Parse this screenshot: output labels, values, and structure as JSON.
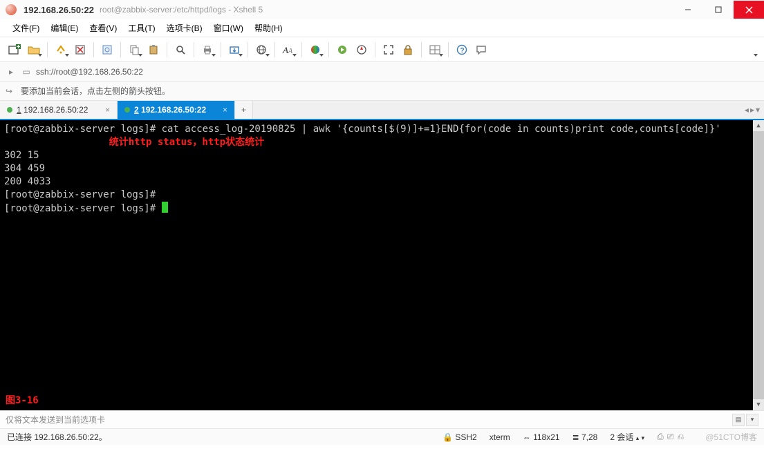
{
  "window": {
    "title_main": "192.168.26.50:22",
    "title_sub": "root@zabbix-server:/etc/httpd/logs - Xshell 5"
  },
  "menu": {
    "file": "文件(F)",
    "edit": "编辑(E)",
    "view": "查看(V)",
    "tools": "工具(T)",
    "tabs": "选项卡(B)",
    "window": "窗口(W)",
    "help": "帮助(H)"
  },
  "address": {
    "url": "ssh://root@192.168.26.50:22"
  },
  "hint": {
    "text": "要添加当前会话，点击左侧的箭头按钮。"
  },
  "tabs": {
    "t1_num": "1",
    "t1_label": "192.168.26.50:22",
    "t2_num": "2",
    "t2_label": "192.168.26.50:22"
  },
  "terminal": {
    "line1": "[root@zabbix-server logs]# cat access_log-20190825 | awk '{counts[$(9)]+=1}END{for(code in counts)print code,counts[code]}'",
    "annotation": "统计http status，http状态统计",
    "line2": "302 15",
    "line3": "304 459",
    "line4": "200 4033",
    "line5": "[root@zabbix-server logs]#",
    "line6": "[root@zabbix-server logs]# ",
    "figure_label": "图3-16"
  },
  "sendbar": {
    "placeholder": "仅将文本发送到当前选项卡"
  },
  "status": {
    "conn": "已连接 192.168.26.50:22。",
    "proto": "SSH2",
    "term": "xterm",
    "size": "118x21",
    "pos": "7,28",
    "sessions": "2 会话",
    "watermark": "@51CTO博客"
  },
  "icons": {
    "lock": "🔒",
    "arrow": "↪",
    "resize": "⇔",
    "rows": "≣"
  }
}
